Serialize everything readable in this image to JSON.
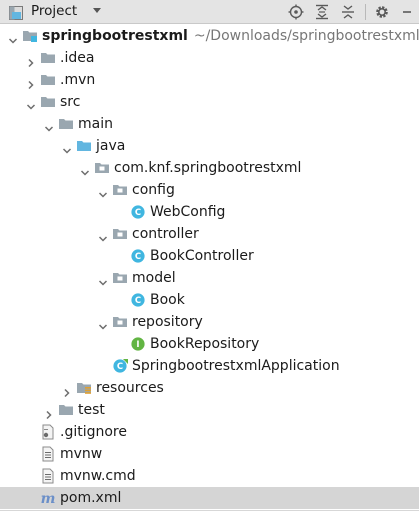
{
  "header": {
    "title": "Project",
    "icons": [
      "project-icon",
      "locate-icon",
      "expand-all-icon",
      "collapse-all-icon",
      "gear-icon",
      "hide-icon"
    ]
  },
  "tree": [
    {
      "label": "springbootrestxml",
      "path": "~/Downloads/springbootrestxml",
      "depth": 0,
      "arrow": "down",
      "icon": "module-folder",
      "bold": true
    },
    {
      "label": ".idea",
      "depth": 1,
      "arrow": "right",
      "icon": "folder"
    },
    {
      "label": ".mvn",
      "depth": 1,
      "arrow": "right",
      "icon": "folder"
    },
    {
      "label": "src",
      "depth": 1,
      "arrow": "down",
      "icon": "folder"
    },
    {
      "label": "main",
      "depth": 2,
      "arrow": "down",
      "icon": "folder"
    },
    {
      "label": "java",
      "depth": 3,
      "arrow": "down",
      "icon": "source-folder"
    },
    {
      "label": "com.knf.springbootrestxml",
      "depth": 4,
      "arrow": "down",
      "icon": "package"
    },
    {
      "label": "config",
      "depth": 5,
      "arrow": "down",
      "icon": "package"
    },
    {
      "label": "WebConfig",
      "depth": 6,
      "arrow": "none",
      "icon": "class"
    },
    {
      "label": "controller",
      "depth": 5,
      "arrow": "down",
      "icon": "package"
    },
    {
      "label": "BookController",
      "depth": 6,
      "arrow": "none",
      "icon": "class"
    },
    {
      "label": "model",
      "depth": 5,
      "arrow": "down",
      "icon": "package"
    },
    {
      "label": "Book",
      "depth": 6,
      "arrow": "none",
      "icon": "class"
    },
    {
      "label": "repository",
      "depth": 5,
      "arrow": "down",
      "icon": "package"
    },
    {
      "label": "BookRepository",
      "depth": 6,
      "arrow": "none",
      "icon": "interface"
    },
    {
      "label": "SpringbootrestxmlApplication",
      "depth": 5,
      "arrow": "none",
      "icon": "spring-class"
    },
    {
      "label": "resources",
      "depth": 3,
      "arrow": "right",
      "icon": "resources-folder"
    },
    {
      "label": "test",
      "depth": 2,
      "arrow": "right",
      "icon": "folder"
    },
    {
      "label": ".gitignore",
      "depth": 1,
      "arrow": "none",
      "icon": "gitignore-file"
    },
    {
      "label": "mvnw",
      "depth": 1,
      "arrow": "none",
      "icon": "text-file"
    },
    {
      "label": "mvnw.cmd",
      "depth": 1,
      "arrow": "none",
      "icon": "text-file"
    },
    {
      "label": "pom.xml",
      "depth": 1,
      "arrow": "none",
      "icon": "maven-file",
      "selected": true
    }
  ],
  "colors": {
    "folder": "#9aa7b0",
    "source_folder": "#62b6e0",
    "class_icon": "#40b6e0",
    "interface_icon": "#62b543",
    "maven": "#6b8fc8",
    "selected_row": "#d5d5d5",
    "header_bg": "#e4e4e4"
  }
}
